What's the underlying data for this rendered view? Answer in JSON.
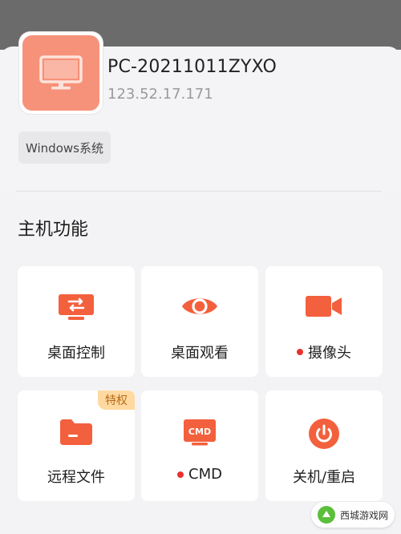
{
  "device": {
    "name": "PC-20211011ZYXO",
    "ip": "123.52.17.171",
    "os_tag": "Windows系统",
    "icon": "monitor-icon"
  },
  "section": {
    "title": "主机功能"
  },
  "tiles": [
    {
      "label": "桌面控制",
      "icon": "desktop-switch-icon",
      "dot": false
    },
    {
      "label": "桌面观看",
      "icon": "eye-icon",
      "dot": false
    },
    {
      "label": "摄像头",
      "icon": "video-camera-icon",
      "dot": true
    },
    {
      "label": "远程文件",
      "icon": "folder-icon",
      "dot": false,
      "badge": "特权"
    },
    {
      "label": "CMD",
      "icon": "cmd-terminal-icon",
      "dot": true,
      "icon_text": "CMD"
    },
    {
      "label": "关机/重启",
      "icon": "power-icon",
      "dot": false
    }
  ],
  "watermark": {
    "text": "西城游戏网"
  },
  "colors": {
    "accent": "#f3603d",
    "device_tile": "#f6927a",
    "red_dot": "#e8322d",
    "badge_bg": "#ffd9a0",
    "badge_text": "#b86a1a"
  }
}
